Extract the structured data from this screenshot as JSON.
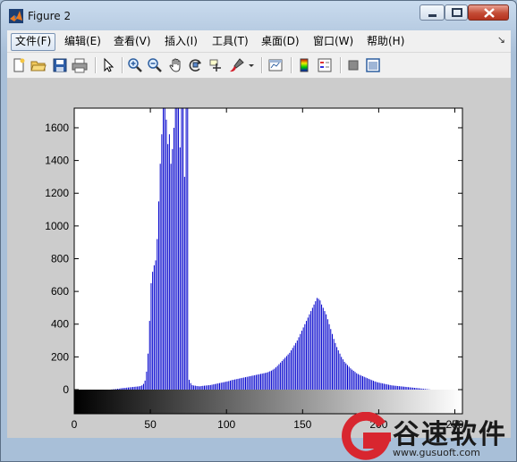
{
  "window": {
    "title": "Figure 2"
  },
  "menu": {
    "items": [
      "文件(F)",
      "编辑(E)",
      "查看(V)",
      "插入(I)",
      "工具(T)",
      "桌面(D)",
      "窗口(W)",
      "帮助(H)"
    ],
    "overflow": "↘"
  },
  "toolbar": {
    "icons": [
      "new-figure-icon",
      "open-file-icon",
      "save-icon",
      "print-icon",
      "select-arrow-icon",
      "zoom-in-icon",
      "zoom-out-icon",
      "pan-hand-icon",
      "rotate-3d-icon",
      "data-cursor-icon",
      "brush-icon",
      "link-plot-icon",
      "colorbar-icon",
      "legend-icon",
      "hide-plot-tools-icon",
      "show-plot-tools-icon"
    ]
  },
  "colors": {
    "bar": "#0000cc",
    "figure_bg": "#cccccc",
    "axes_bg": "#ffffff"
  },
  "chart_data": {
    "type": "bar",
    "title": "",
    "xlabel": "",
    "ylabel": "",
    "xlim": [
      0,
      255
    ],
    "ylim": [
      0,
      1720
    ],
    "xticks": [
      "0",
      "50",
      "100",
      "150",
      "200",
      "250"
    ],
    "yticks": [
      "0",
      "200",
      "400",
      "600",
      "800",
      "1000",
      "1200",
      "1400",
      "1600"
    ],
    "colorbar": "grayscale 0-255",
    "bins": [
      0,
      0,
      0,
      0,
      0,
      0,
      0,
      0,
      0,
      0,
      0,
      0,
      0,
      0,
      0,
      0,
      0,
      0,
      0,
      0,
      0,
      0,
      0,
      0,
      1,
      2,
      3,
      4,
      5,
      6,
      8,
      9,
      10,
      11,
      12,
      13,
      14,
      15,
      16,
      17,
      18,
      19,
      20,
      22,
      26,
      35,
      55,
      110,
      220,
      420,
      650,
      720,
      760,
      790,
      920,
      1150,
      1380,
      1560,
      1720,
      1720,
      1650,
      1500,
      1560,
      1380,
      1470,
      1600,
      1720,
      1720,
      1720,
      1480,
      1720,
      1720,
      1300,
      1720,
      1720,
      60,
      40,
      28,
      25,
      24,
      22,
      21,
      20,
      22,
      23,
      24,
      25,
      26,
      27,
      28,
      30,
      32,
      34,
      36,
      38,
      40,
      42,
      44,
      46,
      48,
      50,
      52,
      55,
      58,
      60,
      62,
      64,
      66,
      68,
      70,
      72,
      74,
      76,
      78,
      80,
      82,
      84,
      86,
      88,
      90,
      92,
      94,
      96,
      98,
      100,
      102,
      104,
      108,
      112,
      116,
      122,
      128,
      136,
      145,
      155,
      165,
      175,
      185,
      195,
      205,
      215,
      225,
      240,
      255,
      270,
      285,
      300,
      320,
      340,
      360,
      380,
      400,
      420,
      440,
      460,
      480,
      500,
      520,
      540,
      560,
      555,
      545,
      520,
      500,
      480,
      460,
      430,
      400,
      370,
      340,
      310,
      285,
      260,
      240,
      220,
      200,
      185,
      170,
      160,
      150,
      140,
      130,
      122,
      115,
      108,
      100,
      95,
      90,
      86,
      82,
      78,
      74,
      70,
      66,
      62,
      58,
      54,
      50,
      47,
      44,
      42,
      40,
      38,
      36,
      34,
      32,
      30,
      28,
      26,
      25,
      24,
      23,
      22,
      21,
      20,
      19,
      18,
      17,
      16,
      15,
      14,
      13,
      12,
      11,
      10,
      9,
      8,
      7,
      6,
      5,
      4,
      3,
      2,
      1,
      0,
      0,
      0,
      0,
      0,
      0,
      0,
      0,
      0,
      0,
      0,
      0,
      0,
      0,
      0
    ]
  },
  "watermark": {
    "brand": "谷速软件",
    "url": "www.gusuoft.com"
  }
}
